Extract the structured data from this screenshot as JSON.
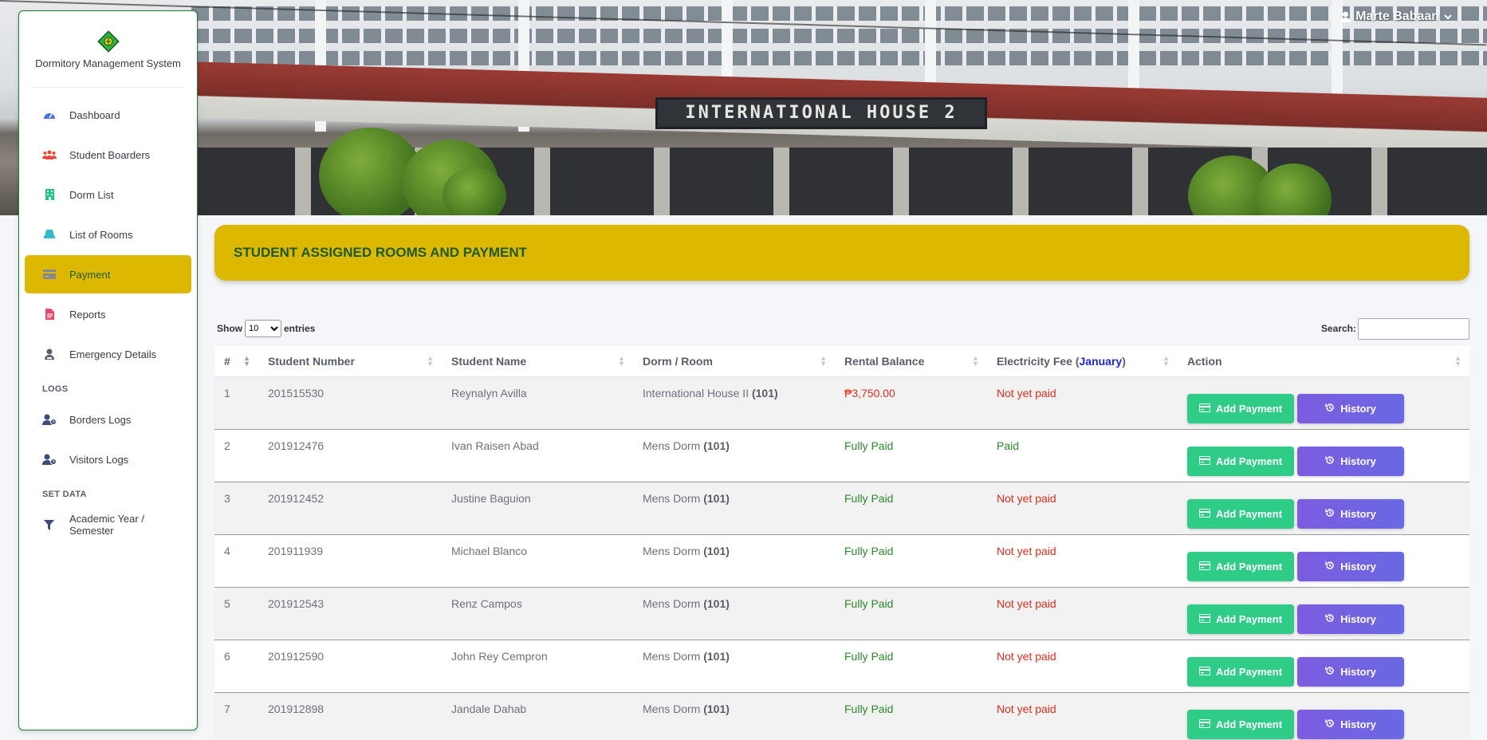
{
  "app": {
    "title": "Dormitory Management System"
  },
  "user": {
    "name": "Marte Babaan"
  },
  "header_image": {
    "sign_text": "INTERNATIONAL HOUSE 2"
  },
  "sidebar": {
    "items": [
      {
        "label": "Dashboard",
        "icon": "dashboard-icon"
      },
      {
        "label": "Student Boarders",
        "icon": "users-icon"
      },
      {
        "label": "Dorm List",
        "icon": "building-icon"
      },
      {
        "label": "List of Rooms",
        "icon": "bed-icon"
      },
      {
        "label": "Payment",
        "icon": "credit-card-icon",
        "active": true
      },
      {
        "label": "Reports",
        "icon": "file-icon"
      },
      {
        "label": "Emergency Details",
        "icon": "user-shield-icon"
      }
    ],
    "logs_heading": "LOGS",
    "logs_items": [
      {
        "label": "Borders Logs",
        "icon": "user-clock-icon"
      },
      {
        "label": "Visitors Logs",
        "icon": "user-clock-icon"
      }
    ],
    "setdata_heading": "SET DATA",
    "setdata_items": [
      {
        "label": "Academic Year / Semester",
        "icon": "filter-icon"
      }
    ]
  },
  "page": {
    "title": "STUDENT ASSIGNED ROOMS AND PAYMENT"
  },
  "datatable": {
    "show_label": "Show",
    "entries_label": "entries",
    "page_length": "10",
    "search_label": "Search:",
    "search_value": ""
  },
  "table": {
    "columns": [
      "#",
      "Student Number",
      "Student Name",
      "Dorm / Room",
      "Rental Balance",
      "Electricity Fee (",
      "January",
      ")",
      "Action"
    ],
    "rows": [
      {
        "num": "1",
        "student_number": "201515530",
        "name": "Reynalyn Avilla",
        "dorm": "International House II ",
        "room": "(101)",
        "rental": "₱3,750.00",
        "electricity": "Not yet paid"
      },
      {
        "num": "2",
        "student_number": "201912476",
        "name": "Ivan Raisen Abad",
        "dorm": "Mens Dorm ",
        "room": "(101)",
        "rental": "Fully Paid",
        "electricity": "Paid"
      },
      {
        "num": "3",
        "student_number": "201912452",
        "name": "Justine Baguion",
        "dorm": "Mens Dorm ",
        "room": "(101)",
        "rental": "Fully Paid",
        "electricity": "Not yet paid"
      },
      {
        "num": "4",
        "student_number": "201911939",
        "name": "Michael Blanco",
        "dorm": "Mens Dorm ",
        "room": "(101)",
        "rental": "Fully Paid",
        "electricity": "Not yet paid"
      },
      {
        "num": "5",
        "student_number": "201912543",
        "name": "Renz Campos",
        "dorm": "Mens Dorm ",
        "room": "(101)",
        "rental": "Fully Paid",
        "electricity": "Not yet paid"
      },
      {
        "num": "6",
        "student_number": "201912590",
        "name": "John Rey Cempron",
        "dorm": "Mens Dorm ",
        "room": "(101)",
        "rental": "Fully Paid",
        "electricity": "Not yet paid"
      },
      {
        "num": "7",
        "student_number": "201912898",
        "name": "Jandale Dahab",
        "dorm": "Mens Dorm ",
        "room": "(101)",
        "rental": "Fully Paid",
        "electricity": "Not yet paid"
      }
    ],
    "add_payment_label": "Add Payment",
    "history_label": "History"
  },
  "colors": {
    "accent_yellow": "#dcb800",
    "dark_green": "#1f5a2a",
    "pay_button": "#2ecc87",
    "history_button": "#7c5ce0",
    "unpaid_red": "#e02d1b",
    "paid_green": "#2b8a2b"
  }
}
